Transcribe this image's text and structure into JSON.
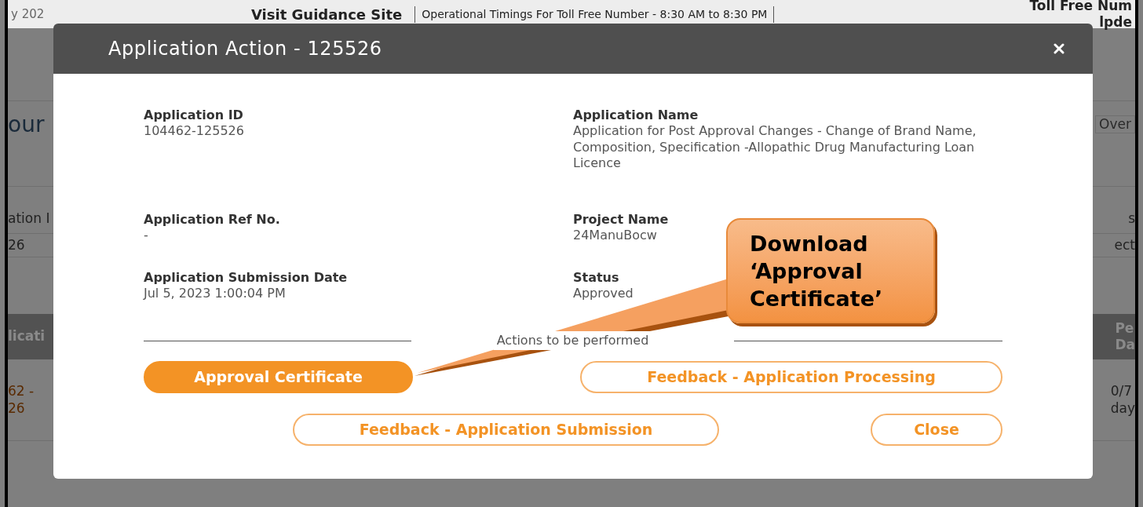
{
  "background_page": {
    "top_bar": {
      "date_fragment": "y 202",
      "guidance_link": "Visit Guidance Site",
      "timings": "Operational Timings For Toll Free Number - 8:30 AM to 8:30 PM",
      "toll_free_fragment": "Toll Free Num",
      "helpdesk_fragment": "lpde"
    },
    "heading_fragment": "our",
    "overview_fragment": "Over",
    "table_header_fragments": [
      "ation I",
      "s"
    ],
    "table_value_fragments": [
      "26",
      "ect"
    ],
    "grid_header_fragments": [
      "licati",
      "Pe\nDa"
    ],
    "grid_cell_fragments": [
      "62 -\n26",
      "0/7\nday"
    ]
  },
  "modal": {
    "title": "Application Action - 125526",
    "fields": [
      {
        "label": "Application ID",
        "value": "104462-125526"
      },
      {
        "label": "Application Name",
        "value": "Application for Post Approval Changes - Change of Brand Name, Composition, Specification -Allopathic Drug Manufacturing Loan Licence"
      },
      {
        "label": "Application Ref No.",
        "value": "-"
      },
      {
        "label": "Project Name",
        "value": "24ManuBocw"
      },
      {
        "label": "Application Submission Date",
        "value": "Jul 5, 2023 1:00:04 PM"
      },
      {
        "label": "Status",
        "value": "Approved"
      }
    ],
    "actions_heading": "Actions to be performed",
    "buttons": [
      {
        "label": "Approval Certificate",
        "kind": "primary"
      },
      {
        "label": "Feedback - Application Processing",
        "kind": "outline"
      },
      {
        "label": "Feedback - Application Submission",
        "kind": "outline"
      },
      {
        "label": "Close",
        "kind": "outline"
      }
    ]
  },
  "callout": {
    "lines": [
      "Download",
      "‘Approval",
      "Certificate’"
    ]
  }
}
